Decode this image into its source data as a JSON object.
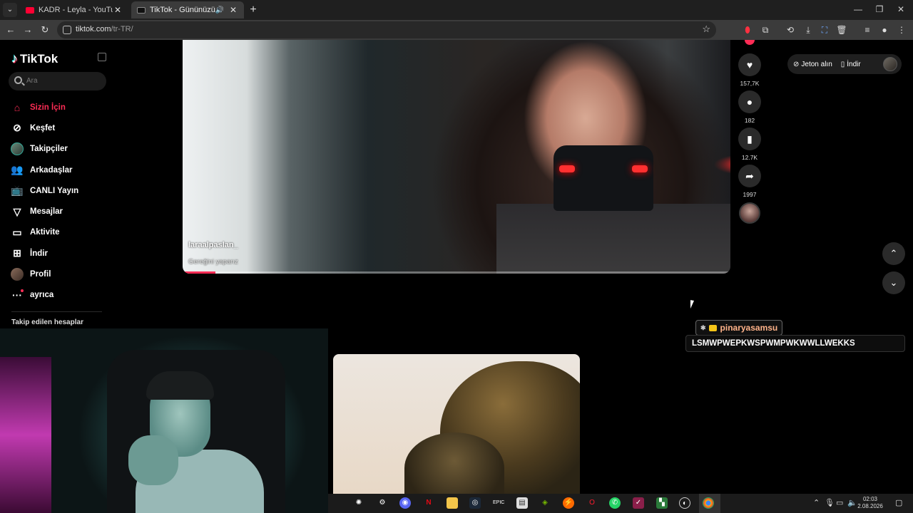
{
  "browser": {
    "tabs": [
      {
        "title": "KADR - Leyla - YouTube",
        "favicon": "youtube-icon"
      },
      {
        "title": "TikTok - Gününüzü Güzelleştirecek",
        "favicon": "tiktok-icon",
        "audio": "speaker-icon"
      }
    ],
    "url_host": "tiktok.com",
    "url_path": "/tr-TR/"
  },
  "sidebar": {
    "logo": "TikTok",
    "search_placeholder": "Ara",
    "items": [
      {
        "label": "Sizin İçin",
        "icon": "home-icon",
        "active": true
      },
      {
        "label": "Keşfet",
        "icon": "compass-icon"
      },
      {
        "label": "Takipçiler",
        "icon": "avatar-icon"
      },
      {
        "label": "Arkadaşlar",
        "icon": "friends-icon"
      },
      {
        "label": "CANLI Yayın",
        "icon": "live-tv-icon"
      },
      {
        "label": "Mesajlar",
        "icon": "send-icon"
      },
      {
        "label": "Aktivite",
        "icon": "inbox-icon"
      },
      {
        "label": "İndir",
        "icon": "download-plus-icon"
      },
      {
        "label": "Profil",
        "icon": "profile-avatar-icon"
      },
      {
        "label": "ayrıca",
        "icon": "more-dots-icon"
      }
    ],
    "following_title": "Takip edilen hesaplar"
  },
  "video": {
    "author": "laraalpaslan_",
    "description": "Gereğini yaparız",
    "progress_percent": 6
  },
  "actions": {
    "likes": "157,7K",
    "comments": "182",
    "saves": "12.7K",
    "shares": "1997"
  },
  "header": {
    "coins_label": "Jeton alın",
    "download_label": "İndir"
  },
  "chat": {
    "username": "pinaryasamsu",
    "message": "LSMWPWEPKWSPWMPWKWWLLWEKKS"
  },
  "taskbar": {
    "time": "02:03",
    "date": "2.08.2026"
  },
  "colors": {
    "accent": "#fe2c55",
    "chat_username": "#ffb38a"
  }
}
